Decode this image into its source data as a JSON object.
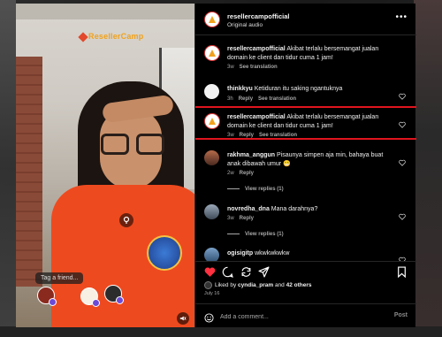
{
  "video": {
    "watermark": "ResellerCamp",
    "tag_prompt": "Tag a friend..."
  },
  "header": {
    "username": "resellercampofficial",
    "audio": "Original audio"
  },
  "comments": [
    {
      "user": "resellercampofficial",
      "text": " Akibat terlalu bersemangat jualan domain ke client dan tidur cuma 1 jam!",
      "time": "3w",
      "action": "See translation",
      "view_replies": ""
    },
    {
      "user": "thinkkyu",
      "text": " Ketiduran itu saking ngantuknya",
      "time": "3h",
      "reply": "Reply",
      "action": "See translation",
      "view_replies": ""
    },
    {
      "user": "resellercampofficial",
      "text": " Akibat terlalu bersemangat jualan domain ke client dan tidur cuma 1 jam!",
      "time": "3w",
      "reply": "Reply",
      "action": "See translation",
      "view_replies": ""
    },
    {
      "user": "rakhma_anggun",
      "text": " Pisaunya simpen aja min, bahaya buat anak dibawah umur 😁",
      "time": "2w",
      "reply": "Reply",
      "view_replies": "View replies (1)"
    },
    {
      "user": "novredha_dna",
      "text": " Mana darahnya?",
      "time": "3w",
      "reply": "Reply",
      "view_replies": "View replies (1)"
    },
    {
      "user": "ogisigitp",
      "text": " wkwkwkwkw",
      "time": "",
      "reply": "",
      "view_replies": ""
    }
  ],
  "likes": {
    "prefix": "Liked by ",
    "user": "cyndia_pram",
    "middle": " and ",
    "others": "42 others"
  },
  "date": "July 16",
  "add_comment": {
    "placeholder": "Add a comment...",
    "post_label": "Post"
  },
  "colors": {
    "like_red": "#ff3040",
    "highlight_red": "#e0141e",
    "panel_bg": "#000000"
  }
}
